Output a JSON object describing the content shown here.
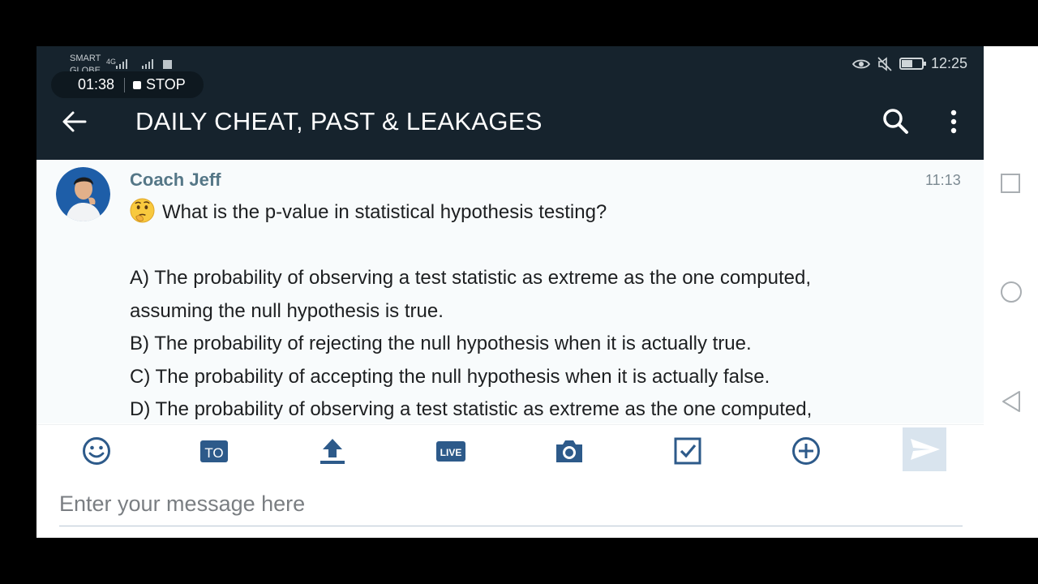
{
  "status_bar": {
    "carrier_primary": "SMART",
    "carrier_secondary": "GLOBE",
    "network_type": "4G",
    "time": "12:25",
    "icons": [
      "signal-icon",
      "signal-icon",
      "eye-icon",
      "mute-icon",
      "battery-icon"
    ]
  },
  "recording": {
    "elapsed": "01:38",
    "stop_label": "STOP"
  },
  "app_bar": {
    "title": "DAILY CHEAT, PAST & LEAKAGES",
    "back_icon": "arrow-left-icon",
    "search_icon": "search-icon",
    "menu_icon": "more-vert-icon"
  },
  "message": {
    "sender": "Coach Jeff",
    "time": "11:13",
    "emoji": "thinking-face-icon",
    "question": "What is the p-value in statistical hypothesis testing?",
    "options": [
      "A) The probability of observing a test statistic as extreme as the one computed,",
      "assuming the null hypothesis is true.",
      "B) The probability of rejecting the null hypothesis when it is actually true.",
      "C) The probability of accepting the null hypothesis when it is actually false.",
      "D) The probability of observing a test statistic as extreme as the one computed,"
    ]
  },
  "toolbar": {
    "to_label": "TO",
    "live_label": "LIVE",
    "items": [
      "emoji-icon",
      "mention-to-icon",
      "upload-icon",
      "live-icon",
      "camera-icon",
      "checkbox-icon",
      "add-circle-icon",
      "send-icon"
    ]
  },
  "composer": {
    "placeholder": "Enter your message here",
    "value": ""
  },
  "nav_bar": {
    "items": [
      "recent-apps-icon",
      "home-icon",
      "back-icon"
    ]
  },
  "colors": {
    "header_bg": "#16232d",
    "accent": "#2d5a8a",
    "sender": "#557787",
    "send_disabled_bg": "#d9e4ee"
  }
}
